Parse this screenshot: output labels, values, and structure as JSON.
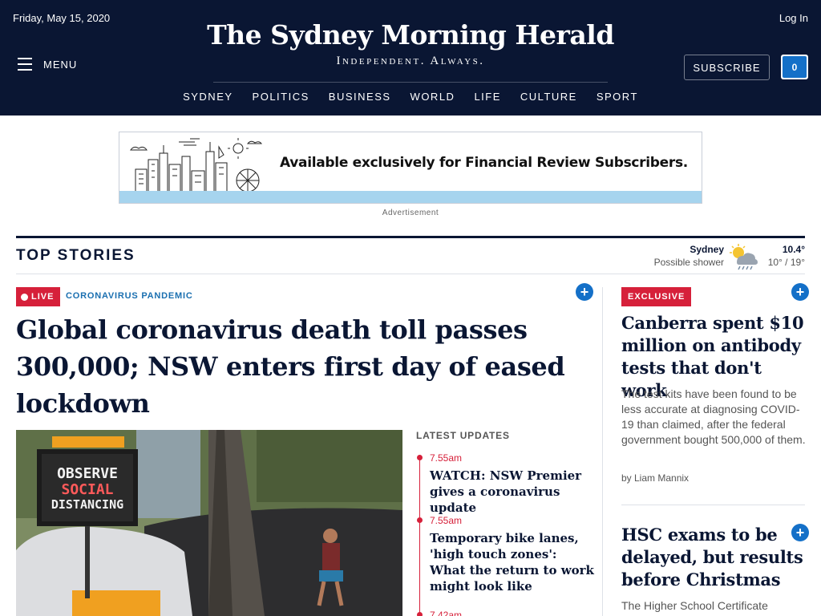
{
  "header": {
    "date": "Friday, May 15, 2020",
    "login": "Log In",
    "logo": "The Sydney Morning Herald",
    "tagline": "Independent. Always.",
    "menu": "MENU",
    "subscribe": "SUBSCRIBE",
    "cart_count": "0",
    "nav": [
      "SYDNEY",
      "POLITICS",
      "BUSINESS",
      "WORLD",
      "LIFE",
      "CULTURE",
      "SPORT"
    ]
  },
  "ad": {
    "text": "Available exclusively for Financial Review Subscribers.",
    "label": "Advertisement"
  },
  "top_stories": {
    "title": "TOP STORIES",
    "weather": {
      "city": "Sydney",
      "description": "Possible shower",
      "temp": "10.4°",
      "range": "10° / 19°"
    }
  },
  "main_story": {
    "live": "LIVE",
    "kicker": "CORONAVIRUS PANDEMIC",
    "headline": "Global coronavirus death toll passes 300,000; NSW enters first day of eased lockdown",
    "photo_sign": [
      "OBSERVE",
      "SOCIAL",
      "DISTANCING"
    ]
  },
  "latest_updates": {
    "title": "LATEST UPDATES",
    "items": [
      {
        "time": "7.55am",
        "text": "WATCH: NSW Premier gives a coronavirus update"
      },
      {
        "time": "7.55am",
        "text": "Temporary bike lanes, 'high touch zones': What the return to work might look like"
      },
      {
        "time": "7.42am",
        "text": ""
      }
    ]
  },
  "right_column": {
    "story1": {
      "badge": "EXCLUSIVE",
      "headline": "Canberra spent $10 million on antibody tests that don't work",
      "body": "The test kits have been found to be less accurate at diagnosing COVID-19 than claimed, after the federal government bought 500,000 of them.",
      "author": "by Liam Mannix"
    },
    "story2": {
      "headline": "HSC exams to be delayed, but results before Christmas",
      "body": "The Higher School Certificate"
    }
  },
  "colors": {
    "navy": "#0a1633",
    "red": "#d6203a",
    "blue": "#1470c8"
  }
}
